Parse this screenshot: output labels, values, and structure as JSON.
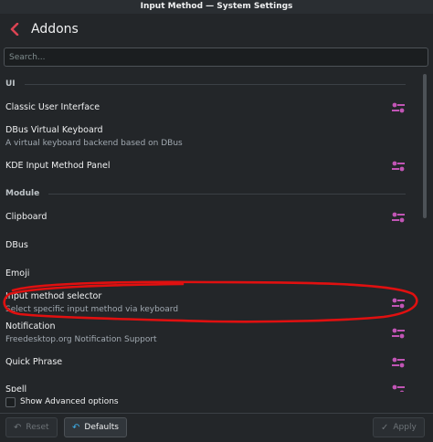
{
  "window": {
    "title": "Input Method — System Settings"
  },
  "header": {
    "title": "Addons"
  },
  "search": {
    "placeholder": "Search..."
  },
  "sections": [
    {
      "label": "UI"
    },
    {
      "label": "Module"
    }
  ],
  "items": [
    {
      "name": "Classic User Interface",
      "description": "",
      "configurable": true
    },
    {
      "name": "DBus Virtual Keyboard",
      "description": "A virtual keyboard backend based on DBus",
      "configurable": false
    },
    {
      "name": "KDE Input Method Panel",
      "description": "",
      "configurable": true
    },
    {
      "name": "Clipboard",
      "description": "",
      "configurable": true
    },
    {
      "name": "DBus",
      "description": "",
      "configurable": false
    },
    {
      "name": "Emoji",
      "description": "",
      "configurable": false
    },
    {
      "name": "Input method selector",
      "description": "Select specific input method via keyboard",
      "configurable": true
    },
    {
      "name": "Notification",
      "description": "Freedesktop.org Notification Support",
      "configurable": true
    },
    {
      "name": "Quick Phrase",
      "description": "",
      "configurable": true
    },
    {
      "name": "Spell",
      "description": "",
      "configurable": true
    }
  ],
  "advanced": {
    "label": "Show Advanced options",
    "checked": false
  },
  "footer": {
    "reset_label": "Reset",
    "defaults_label": "Defaults",
    "apply_label": "Apply"
  },
  "colors": {
    "background": "#232629",
    "accent_back_arrow": "#da4453",
    "config_icon": "#c155b5",
    "annotation": "#e01010"
  },
  "icons": {
    "back": "chevron-left-icon",
    "configure": "configure-icon",
    "reset": "undo-icon",
    "defaults": "restore-defaults-icon",
    "apply": "checkmark-icon"
  }
}
